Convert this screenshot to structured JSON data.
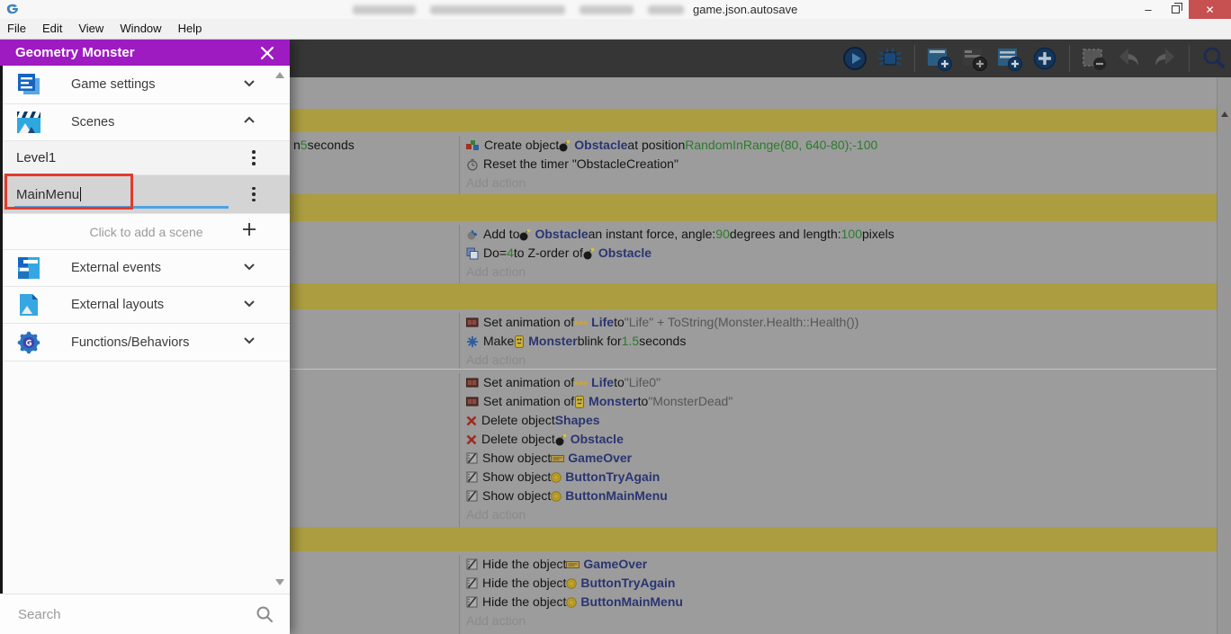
{
  "window": {
    "title_visible": "game.json.autosave",
    "controls": {
      "minimize_glyph": "–",
      "close_glyph": "✕"
    }
  },
  "menu_bar": {
    "items": [
      "File",
      "Edit",
      "View",
      "Window",
      "Help"
    ]
  },
  "toolbar": {
    "buttons": [
      "play",
      "debug",
      "add-event",
      "add-subevent",
      "add-comment",
      "add-other-event",
      "delete-event",
      "undo",
      "redo",
      "search"
    ]
  },
  "icons": {
    "close": "✕",
    "minimize": "–",
    "restore": "❐",
    "search": "🔍",
    "kebab": "⋮",
    "plus": "＋",
    "chevron-down": "⌄",
    "chevron-up": "⌃",
    "play": "▶",
    "bomb": "💣"
  },
  "project_manager": {
    "title": "Geometry Monster",
    "rows": {
      "game_settings": "Game settings",
      "scenes": "Scenes",
      "external_events": "External events",
      "external_layouts": "External layouts",
      "functions": "Functions/Behaviors"
    },
    "scenes": [
      {
        "name": "Level1",
        "editing": false
      },
      {
        "name": "MainMenu",
        "editing": true
      }
    ],
    "add_scene_label": "Click to add a scene",
    "search_placeholder": "Search"
  },
  "events_sheet": {
    "blocks": [
      {
        "kind": "comment"
      },
      {
        "kind": "event",
        "conditions": [
          [
            {
              "t": "n ",
              "s": "plain"
            },
            {
              "t": "5",
              "s": "value"
            },
            {
              "t": " seconds",
              "s": "plain"
            }
          ]
        ],
        "actions": [
          {
            "icon": "create-object",
            "segs": [
              {
                "t": "Create object ",
                "s": "plain"
              },
              {
                "icon": "bomb"
              },
              {
                "t": "Obstacle",
                "s": "object"
              },
              {
                "t": " at position ",
                "s": "plain"
              },
              {
                "t": "RandomInRange(80, 640-80);-100",
                "s": "value"
              }
            ]
          },
          {
            "icon": "timer",
            "segs": [
              {
                "t": "Reset the timer \"ObstacleCreation\"",
                "s": "plain"
              }
            ]
          },
          {
            "segs": [
              {
                "t": "Add action",
                "s": "muted"
              }
            ]
          }
        ]
      },
      {
        "kind": "comment"
      },
      {
        "kind": "event",
        "conditions": [],
        "actions": [
          {
            "icon": "force",
            "segs": [
              {
                "t": "Add to ",
                "s": "plain"
              },
              {
                "icon": "bomb"
              },
              {
                "t": "Obstacle",
                "s": "object"
              },
              {
                "t": " an instant force, angle: ",
                "s": "plain"
              },
              {
                "t": "90",
                "s": "value"
              },
              {
                "t": " degrees and length: ",
                "s": "plain"
              },
              {
                "t": "100",
                "s": "value"
              },
              {
                "t": " pixels",
                "s": "plain"
              }
            ]
          },
          {
            "icon": "zorder",
            "segs": [
              {
                "t": "Do ",
                "s": "plain"
              },
              {
                "t": "= ",
                "s": "plain"
              },
              {
                "t": "4",
                "s": "value"
              },
              {
                "t": " to Z-order of ",
                "s": "plain"
              },
              {
                "icon": "bomb"
              },
              {
                "t": "Obstacle",
                "s": "object"
              }
            ]
          },
          {
            "segs": [
              {
                "t": "Add action",
                "s": "muted"
              }
            ]
          }
        ]
      },
      {
        "kind": "comment"
      },
      {
        "kind": "event",
        "conditions": [],
        "actions": [
          {
            "icon": "set-animation",
            "segs": [
              {
                "t": "Set animation of ",
                "s": "plain"
              },
              {
                "icon": "hearts"
              },
              {
                "t": "Life",
                "s": "object"
              },
              {
                "t": " to ",
                "s": "plain"
              },
              {
                "t": "\"Life\" + ToString(Monster.Health::Health())",
                "s": "string"
              }
            ]
          },
          {
            "icon": "blink",
            "segs": [
              {
                "t": "Make ",
                "s": "plain"
              },
              {
                "icon": "monster"
              },
              {
                "t": "Monster",
                "s": "object"
              },
              {
                "t": " blink for ",
                "s": "plain"
              },
              {
                "t": "1.5",
                "s": "value"
              },
              {
                "t": " seconds",
                "s": "plain"
              }
            ]
          },
          {
            "segs": [
              {
                "t": "Add action",
                "s": "muted"
              }
            ]
          }
        ]
      },
      {
        "kind": "event",
        "divider_top": true,
        "conditions": [],
        "actions": [
          {
            "icon": "set-animation",
            "segs": [
              {
                "t": "Set animation of ",
                "s": "plain"
              },
              {
                "icon": "hearts"
              },
              {
                "t": "Life",
                "s": "object"
              },
              {
                "t": " to ",
                "s": "plain"
              },
              {
                "t": "\"Life0\"",
                "s": "string"
              }
            ]
          },
          {
            "icon": "set-animation",
            "segs": [
              {
                "t": "Set animation of ",
                "s": "plain"
              },
              {
                "icon": "monster"
              },
              {
                "t": "Monster",
                "s": "object"
              },
              {
                "t": " to ",
                "s": "plain"
              },
              {
                "t": "\"MonsterDead\"",
                "s": "string"
              }
            ]
          },
          {
            "icon": "delete",
            "segs": [
              {
                "t": "Delete object ",
                "s": "plain"
              },
              {
                "t": "Shapes",
                "s": "object"
              }
            ]
          },
          {
            "icon": "delete",
            "segs": [
              {
                "t": "Delete object ",
                "s": "plain"
              },
              {
                "icon": "bomb"
              },
              {
                "t": "Obstacle",
                "s": "object"
              }
            ]
          },
          {
            "icon": "visibility",
            "segs": [
              {
                "t": "Show object ",
                "s": "plain"
              },
              {
                "icon": "banner"
              },
              {
                "t": "GameOver",
                "s": "object"
              }
            ]
          },
          {
            "icon": "visibility",
            "segs": [
              {
                "t": "Show object ",
                "s": "plain"
              },
              {
                "icon": "coin"
              },
              {
                "t": "ButtonTryAgain",
                "s": "object"
              }
            ]
          },
          {
            "icon": "visibility",
            "segs": [
              {
                "t": "Show object ",
                "s": "plain"
              },
              {
                "icon": "coin"
              },
              {
                "t": "ButtonMainMenu",
                "s": "object"
              }
            ]
          },
          {
            "segs": [
              {
                "t": "Add action",
                "s": "muted"
              }
            ]
          }
        ]
      },
      {
        "kind": "comment"
      },
      {
        "kind": "event",
        "conditions": [],
        "actions": [
          {
            "icon": "visibility",
            "segs": [
              {
                "t": "Hide the object ",
                "s": "plain"
              },
              {
                "icon": "banner"
              },
              {
                "t": "GameOver",
                "s": "object"
              }
            ]
          },
          {
            "icon": "visibility",
            "segs": [
              {
                "t": "Hide the object ",
                "s": "plain"
              },
              {
                "icon": "coin"
              },
              {
                "t": "ButtonTryAgain",
                "s": "object"
              }
            ]
          },
          {
            "icon": "visibility",
            "segs": [
              {
                "t": "Hide the object ",
                "s": "plain"
              },
              {
                "icon": "coin"
              },
              {
                "t": "ButtonMainMenu",
                "s": "object"
              }
            ]
          },
          {
            "segs": [
              {
                "t": "Add action",
                "s": "muted"
              }
            ]
          }
        ]
      }
    ]
  }
}
